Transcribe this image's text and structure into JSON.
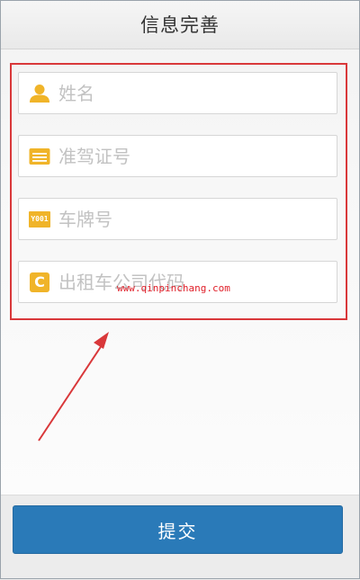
{
  "header": {
    "title": "信息完善"
  },
  "form": {
    "fields": [
      {
        "icon": "user-icon",
        "placeholder": "姓名"
      },
      {
        "icon": "license-card-icon",
        "placeholder": "准驾证号"
      },
      {
        "icon": "plate-badge-icon",
        "badge_text": "Y001",
        "placeholder": "车牌号"
      },
      {
        "icon": "company-c-icon",
        "badge_text": "C",
        "placeholder": "出租车公司代码"
      }
    ]
  },
  "watermark": {
    "text": "www.qinpinchang.com"
  },
  "actions": {
    "submit_label": "提交"
  },
  "colors": {
    "accent": "#2a7ab8",
    "icon": "#f0b429",
    "highlight": "#d9383a"
  }
}
